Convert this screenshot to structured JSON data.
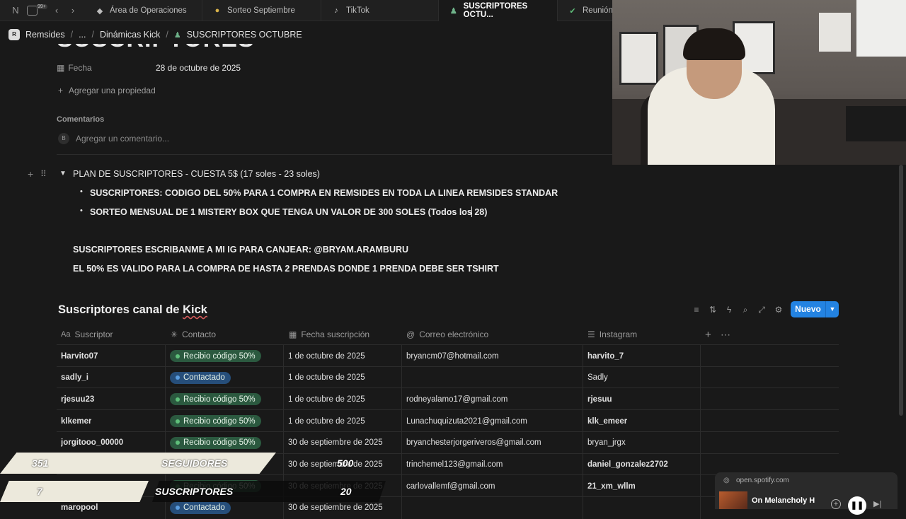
{
  "tabs": [
    {
      "label": "Área de Operaciones",
      "icon": "page-icon"
    },
    {
      "label": "Sorteo Septiembre",
      "icon": "bulb-icon"
    },
    {
      "label": "TikTok",
      "icon": "tiktok-icon"
    },
    {
      "label": "SUSCRIPTORES OCTU...",
      "icon": "people-icon"
    },
    {
      "label": "Reunión T",
      "icon": "check-icon"
    }
  ],
  "tabbar_badge": "99+",
  "breadcrumb": {
    "workspace": "Remsides",
    "ellipsis": "...",
    "parent": "Dinámicas Kick",
    "current": "SUSCRIPTORES OCTUBRE"
  },
  "page": {
    "title_partial": "SUSCRIPTORES OCTUBRE",
    "date_label": "Fecha",
    "date_value": "28 de octubre de 2025",
    "add_property": "Agregar una propiedad",
    "comments_heading": "Comentarios",
    "comment_avatar": "B",
    "comment_placeholder": "Agregar un comentario...",
    "toggle_heading": "PLAN DE SUSCRIPTORES - CUESTA 5$ (17 soles - 23 soles)",
    "bullets": [
      "SUSCRIPTORES: CODIGO DEL 50% PARA 1 COMPRA EN REMSIDES EN TODA LA LINEA REMSIDES STANDAR",
      "SORTEO MENSUAL DE 1 MISTERY BOX QUE TENGA UN VALOR DE 300 SOLES (Todos los 28)"
    ],
    "line1": "SUSCRIPTORES ESCRIBANME A MI IG PARA CANJEAR: @BRYAM.ARAMBURU",
    "line2": "EL 50% ES VALIDO PARA LA COMPRA DE HASTA 2 PRENDAS DONDE 1 PRENDA DEBE SER TSHIRT"
  },
  "database": {
    "title_prefix": "Suscriptores canal de ",
    "title_highlight": "Kick",
    "new_button": "Nuevo",
    "columns": [
      "Suscriptor",
      "Contacto",
      "Fecha suscripción",
      "Correo electrónico",
      "Instagram"
    ],
    "rows": [
      {
        "name": "Harvito07",
        "status": "Recibio código 50%",
        "status_color": "green",
        "date": "1 de octubre de 2025",
        "email": "bryancm07@hotmail.com",
        "ig": "harvito_7",
        "ig_bold": true
      },
      {
        "name": "sadly_i",
        "status": "Contactado",
        "status_color": "blue",
        "date": "1 de octubre de 2025",
        "email": "",
        "ig": "Sadly",
        "ig_bold": false
      },
      {
        "name": "rjesuu23",
        "status": "Recibio código 50%",
        "status_color": "green",
        "date": "1 de octubre de 2025",
        "email": "rodneyalamo17@gmail.com",
        "ig": "rjesuu",
        "ig_bold": true
      },
      {
        "name": "klkemer",
        "status": "Recibio código 50%",
        "status_color": "green",
        "date": "1 de octubre de 2025",
        "email": "Lunachuquizuta2021@gmail.com",
        "ig": "klk_emeer",
        "ig_bold": true
      },
      {
        "name": "jorgitooo_00000",
        "status": "Recibio código 50%",
        "status_color": "green",
        "date": "30 de septiembre de 2025",
        "email": "bryanchesterjorgeriveros@gmail.com",
        "ig": "bryan_jrgx",
        "ig_bold": false
      },
      {
        "name": "",
        "status": "",
        "status_color": "green",
        "date": "30 de septiembre de 2025",
        "email": "trinchemel123@gmail.com",
        "ig": "daniel_gonzalez2702",
        "ig_bold": true
      },
      {
        "name": "",
        "status": "Recibio código 50%",
        "status_color": "green",
        "date": "30 de septiembre de 2025",
        "email": "carlovallemf@gmail.com",
        "ig": "21_xm_wllm",
        "ig_bold": true
      },
      {
        "name": "maropool",
        "status": "Contactado",
        "status_color": "blue",
        "date": "30 de septiembre de 2025",
        "email": "",
        "ig": "",
        "ig_bold": false
      }
    ]
  },
  "overlay": {
    "followers_current": "351",
    "followers_label": "SEGUIDORES",
    "followers_goal": "500",
    "subs_current": "7",
    "subs_label": "SUSCRIPTORES",
    "subs_goal": "20"
  },
  "spotify": {
    "source": "open.spotify.com",
    "track": "On Melancholy H"
  },
  "colors": {
    "accent": "#2383e2",
    "bg": "#191919",
    "green_pill": "#2b593f",
    "blue_pill": "#264e7a"
  }
}
